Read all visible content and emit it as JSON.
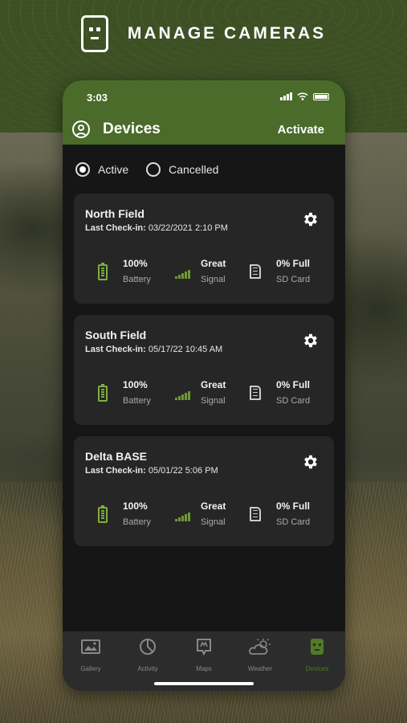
{
  "header": {
    "title": "MANAGE CAMERAS",
    "icon": "camera-face-icon"
  },
  "status_bar": {
    "time": "3:03"
  },
  "app_bar": {
    "title": "Devices",
    "action": "Activate"
  },
  "filters": [
    {
      "label": "Active",
      "selected": true
    },
    {
      "label": "Cancelled",
      "selected": false
    }
  ],
  "devices": [
    {
      "name": "North Field",
      "checkin_label": "Last Check-in:",
      "checkin": "03/22/2021 2:10 PM",
      "battery": "100%",
      "battery_label": "Battery",
      "signal": "Great",
      "signal_label": "Signal",
      "sd": "0% Full",
      "sd_label": "SD Card"
    },
    {
      "name": "South Field",
      "checkin_label": "Last Check-in:",
      "checkin": "05/17/22 10:45 AM",
      "battery": "100%",
      "battery_label": "Battery",
      "signal": "Great",
      "signal_label": "Signal",
      "sd": "0% Full",
      "sd_label": "SD Card"
    },
    {
      "name": "Delta BASE",
      "checkin_label": "Last Check-in:",
      "checkin": "05/01/22 5:06 PM",
      "battery": "100%",
      "battery_label": "Battery",
      "signal": "Great",
      "signal_label": "Signal",
      "sd": "0% Full",
      "sd_label": "SD Card"
    }
  ],
  "tabs": [
    {
      "label": "Gallery",
      "icon": "gallery-icon",
      "active": false
    },
    {
      "label": "Activity",
      "icon": "activity-icon",
      "active": false
    },
    {
      "label": "Maps",
      "icon": "maps-icon",
      "active": false
    },
    {
      "label": "Weather",
      "icon": "weather-icon",
      "active": false
    },
    {
      "label": "Devices",
      "icon": "devices-icon",
      "active": true
    }
  ],
  "colors": {
    "brand_green": "#4a6b2a",
    "accent_green": "#7fae3f",
    "card_bg": "#262626"
  }
}
